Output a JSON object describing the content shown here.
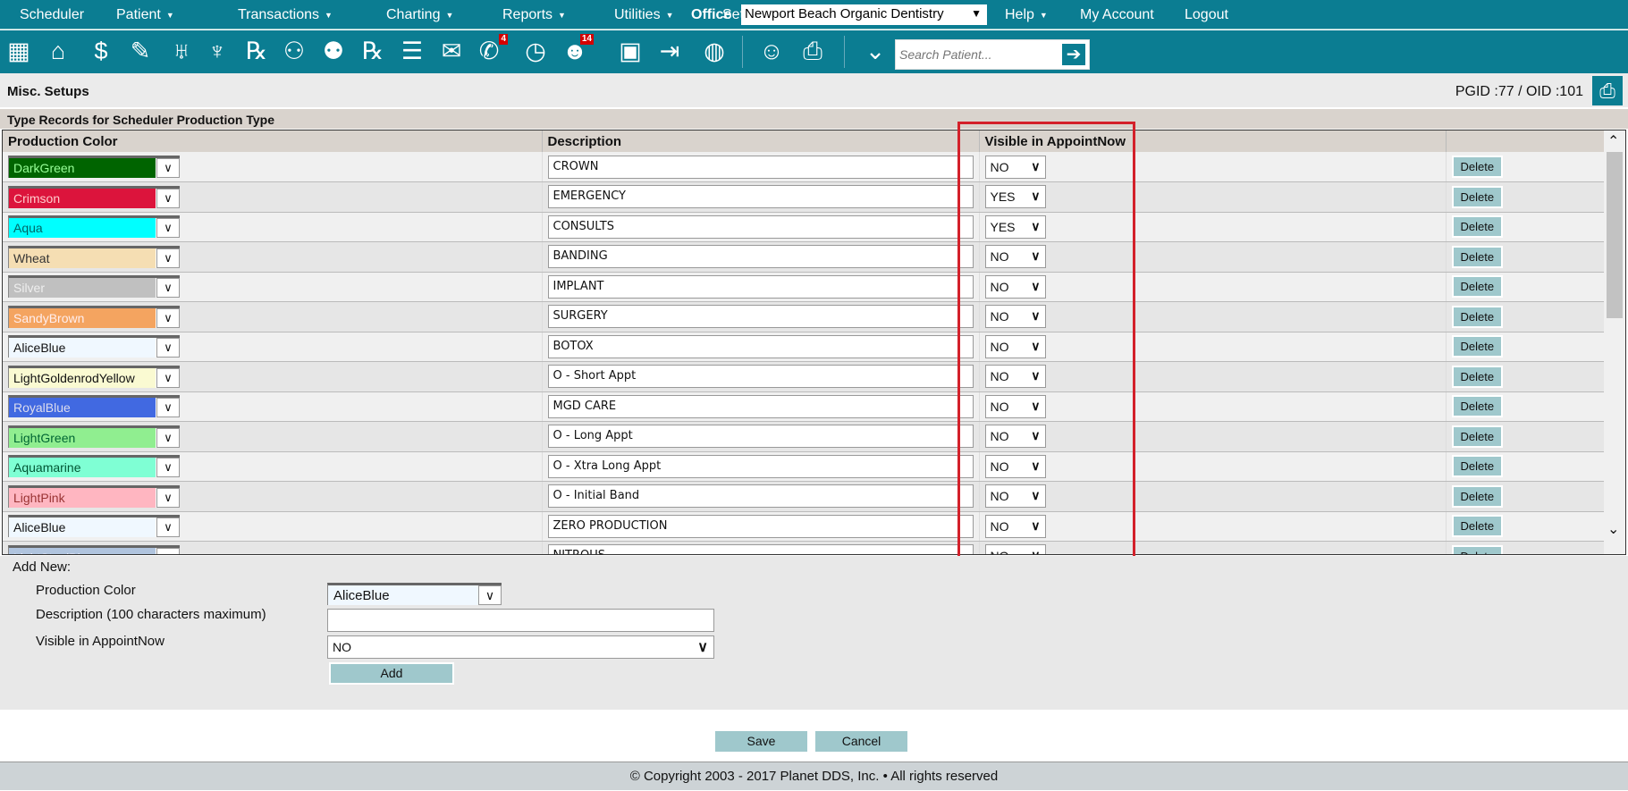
{
  "nav": {
    "items": [
      {
        "label": "Scheduler",
        "caret": false
      },
      {
        "label": "Patient",
        "caret": true
      },
      {
        "label": "Transactions",
        "caret": true
      },
      {
        "label": "Charting",
        "caret": true
      },
      {
        "label": "Reports",
        "caret": true
      },
      {
        "label": "Utilities",
        "caret": true
      },
      {
        "label": "Setup",
        "caret": true
      }
    ],
    "office_label": "Office",
    "office_value": "Newport Beach Organic Dentistry",
    "right_items": [
      {
        "label": "Help",
        "caret": true
      },
      {
        "label": "My Account"
      },
      {
        "label": "Logout"
      }
    ],
    "caret": "▼"
  },
  "toolbar": {
    "icons": [
      {
        "name": "calendar-icon",
        "glyph": "▦"
      },
      {
        "name": "home-icon",
        "glyph": "⌂"
      },
      {
        "name": "billing-icon",
        "glyph": "$"
      },
      {
        "name": "notes-icon",
        "glyph": "✎"
      },
      {
        "name": "tooth-icon",
        "glyph": "♅"
      },
      {
        "name": "crown-icon",
        "glyph": "♆"
      },
      {
        "name": "treatment-icon",
        "glyph": "℞"
      },
      {
        "name": "add-patient-icon",
        "glyph": "⚇"
      },
      {
        "name": "add-family-icon",
        "glyph": "⚉"
      },
      {
        "name": "prescription-icon",
        "glyph": "℞"
      },
      {
        "name": "notepad-icon",
        "glyph": "☰"
      },
      {
        "name": "mail-icon",
        "glyph": "✉"
      },
      {
        "name": "messages-icon",
        "glyph": "✆",
        "badge": "4"
      },
      {
        "name": "clock-icon",
        "glyph": "◷"
      },
      {
        "name": "online-users-icon",
        "glyph": "☻",
        "badge": "14"
      },
      {
        "name": "xray-icon",
        "glyph": "▣"
      },
      {
        "name": "export-icon",
        "glyph": "⇥"
      },
      {
        "name": "globe-icon",
        "glyph": "◍"
      },
      {
        "name": "users-icon",
        "glyph": "☺"
      },
      {
        "name": "print-reports-icon",
        "glyph": "⎙"
      },
      {
        "name": "expand-icon",
        "glyph": "⌄"
      }
    ],
    "search_placeholder": "Search Patient...",
    "search_go": "➔"
  },
  "header": {
    "title": "Misc. Setups",
    "ids": "PGID :77  /  OID :101"
  },
  "section_title": "Type Records for Scheduler Production Type",
  "table": {
    "columns": [
      "Production Color",
      "Description",
      "Visible in AppointNow",
      ""
    ],
    "rows": [
      {
        "color": "DarkGreen",
        "bg": "#006400",
        "fg": "#9f9",
        "desc": "CROWN",
        "visible": "NO"
      },
      {
        "color": "Crimson",
        "bg": "#dc143c",
        "fg": "#fcc",
        "desc": "EMERGENCY",
        "visible": "YES"
      },
      {
        "color": "Aqua",
        "bg": "#00ffff",
        "fg": "#066",
        "desc": "CONSULTS",
        "visible": "YES"
      },
      {
        "color": "Wheat",
        "bg": "#f5deb3",
        "fg": "#333",
        "desc": "BANDING",
        "visible": "NO"
      },
      {
        "color": "Silver",
        "bg": "#c0c0c0",
        "fg": "#eee",
        "desc": "IMPLANT",
        "visible": "NO"
      },
      {
        "color": "SandyBrown",
        "bg": "#f4a460",
        "fg": "#fee",
        "desc": "SURGERY",
        "visible": "NO"
      },
      {
        "color": "AliceBlue",
        "bg": "#f0f8ff",
        "fg": "#111",
        "desc": "BOTOX",
        "visible": "NO"
      },
      {
        "color": "LightGoldenrodYellow",
        "bg": "#fafad2",
        "fg": "#111",
        "desc": "O - Short Appt",
        "visible": "NO"
      },
      {
        "color": "RoyalBlue",
        "bg": "#4169e1",
        "fg": "#dde",
        "desc": "MGD CARE",
        "visible": "NO"
      },
      {
        "color": "LightGreen",
        "bg": "#90ee90",
        "fg": "#063",
        "desc": "O - Long Appt",
        "visible": "NO"
      },
      {
        "color": "Aquamarine",
        "bg": "#7fffd4",
        "fg": "#053",
        "desc": "O - Xtra Long Appt",
        "visible": "NO"
      },
      {
        "color": "LightPink",
        "bg": "#ffb6c1",
        "fg": "#933",
        "desc": "O - Initial Band",
        "visible": "NO"
      },
      {
        "color": "AliceBlue",
        "bg": "#f0f8ff",
        "fg": "#111",
        "desc": "ZERO PRODUCTION",
        "visible": "NO"
      },
      {
        "color": "LightSteelBlue",
        "bg": "#b0c4de",
        "fg": "#eef",
        "desc": "NITROUS",
        "visible": "NO"
      }
    ],
    "delete_label": "Delete",
    "chevron": "∨"
  },
  "add_new": {
    "title": "Add New:",
    "color_label": "Production Color",
    "color_value": "AliceBlue",
    "desc_label": "Description (100 characters maximum)",
    "desc_value": "",
    "visible_label": "Visible in AppointNow",
    "visible_value": "NO",
    "add_label": "Add"
  },
  "actions": {
    "save": "Save",
    "cancel": "Cancel"
  },
  "footer": "© Copyright 2003 - 2017 Planet DDS, Inc. • All rights reserved",
  "colors": {
    "brand": "#0b7d92",
    "button": "#9fc8cc",
    "highlight": "#d3202a"
  }
}
